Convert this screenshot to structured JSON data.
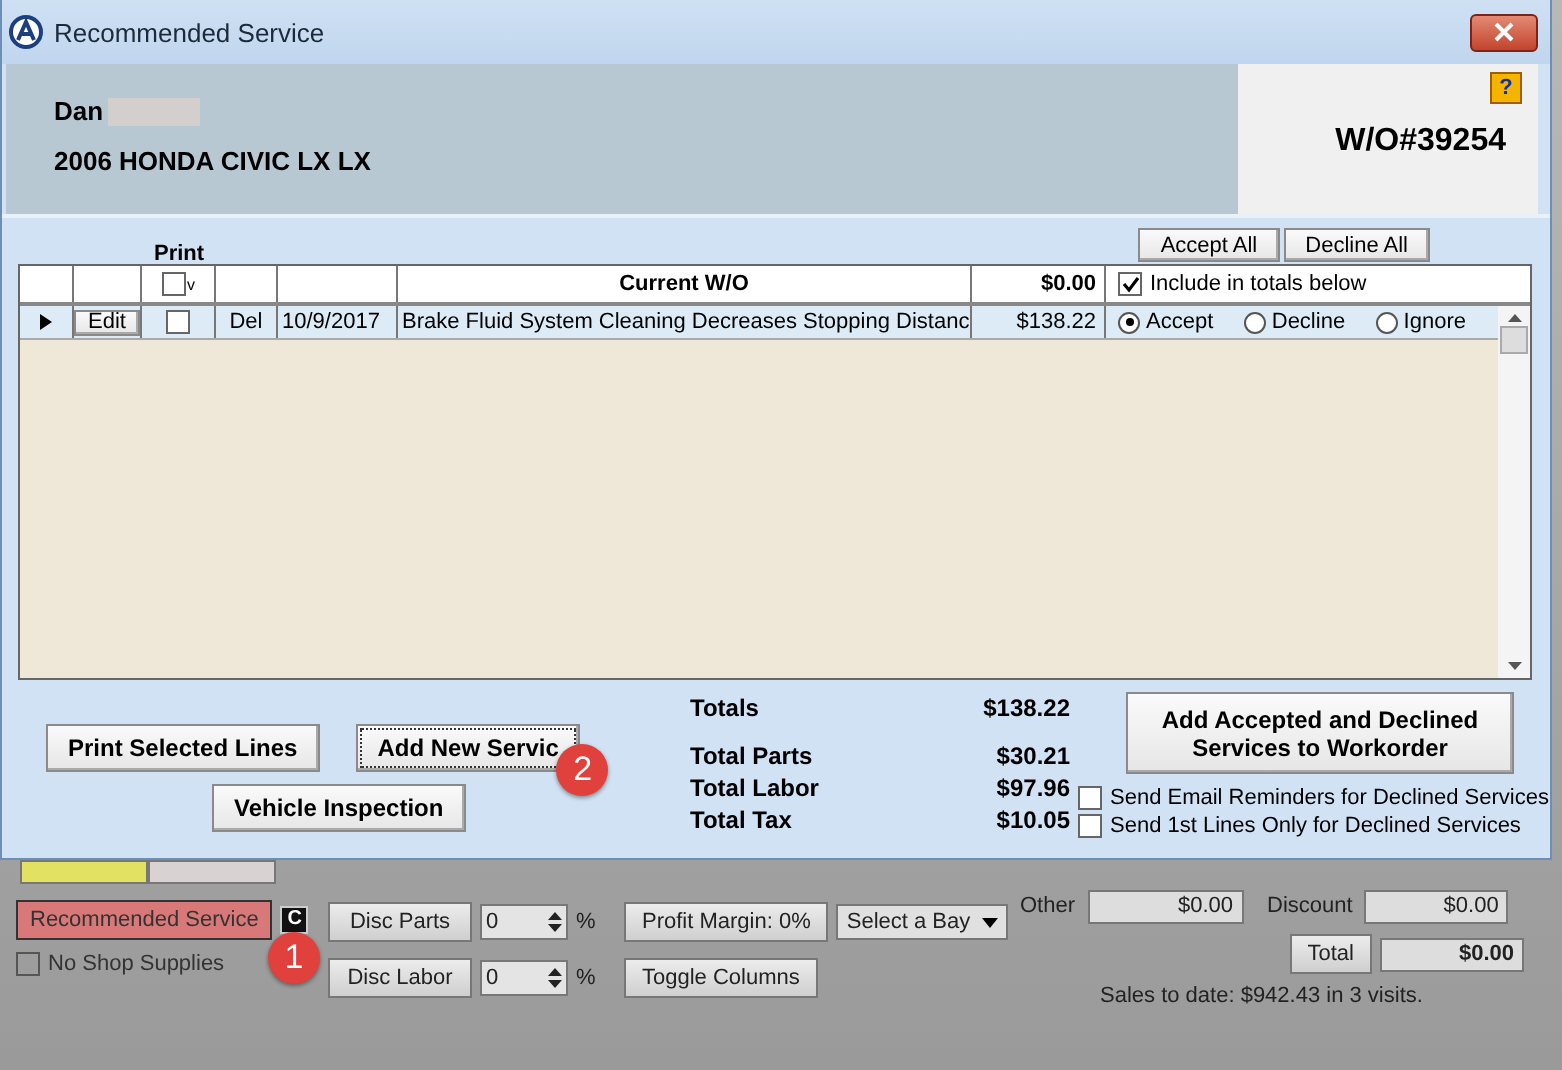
{
  "window": {
    "title": "Recommended Service"
  },
  "header": {
    "customer": "Dan",
    "vehicle": "2006 HONDA CIVIC LX LX",
    "help": "?",
    "work_order": "W/O#39254"
  },
  "grid": {
    "print_label": "Print",
    "actions": [
      "Accept All",
      "Decline All"
    ],
    "header_row": {
      "print_checked": false,
      "print_mark": "v",
      "title": "Current W/O",
      "amount": "$0.00",
      "include_label": "Include in totals below",
      "include_checked": true
    },
    "rows": [
      {
        "edit": "Edit",
        "print_checked": false,
        "delete": "Del",
        "date": "10/9/2017",
        "description": "Brake Fluid System Cleaning Decreases Stopping Distanc",
        "amount": "$138.22",
        "choices": [
          {
            "label": "Accept",
            "selected": true
          },
          {
            "label": "Decline",
            "selected": false
          },
          {
            "label": "Ignore",
            "selected": false
          }
        ]
      }
    ]
  },
  "buttons": [
    {
      "label": "Print Selected Lines"
    },
    {
      "label": "Add New Servic",
      "badge": "2"
    },
    {
      "label": "Vehicle Inspection"
    }
  ],
  "totals": {
    "title": "Totals",
    "total": "$138.22",
    "lines": [
      {
        "label": "Total Parts",
        "value": "$30.21"
      },
      {
        "label": "Total Labor",
        "value": "$97.96"
      },
      {
        "label": "Total Tax",
        "value": "$10.05"
      }
    ]
  },
  "add_button": "Add Accepted and Declined Services to Workorder",
  "options": [
    {
      "label": "Send Email Reminders for Declined Services",
      "checked": false
    },
    {
      "label": "Send 1st Lines Only for Declined Services",
      "checked": false
    }
  ],
  "background": {
    "recommended_button": {
      "label": "Recommended Service",
      "badge": "1"
    },
    "c_button": "C",
    "no_shop_supplies": {
      "label": "No Shop Supplies",
      "checked": false
    },
    "discounts": [
      {
        "label": "Disc Parts",
        "value": "0",
        "unit": "%"
      },
      {
        "label": "Disc Labor",
        "value": "0",
        "unit": "%"
      }
    ],
    "profit_margin": "Profit Margin: 0%",
    "toggle_columns": "Toggle Columns",
    "bay_select": "Select a Bay",
    "other": {
      "label": "Other",
      "value": "$0.00"
    },
    "discount": {
      "label": "Discount",
      "value": "$0.00"
    },
    "total": {
      "label": "Total",
      "value": "$0.00"
    },
    "sales_to_date": "Sales to date: $942.43 in 3 visits."
  }
}
